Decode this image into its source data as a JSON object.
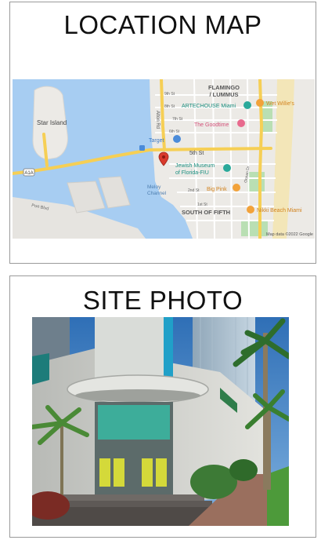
{
  "map_section": {
    "heading": "LOCATION MAP",
    "labels": {
      "neighborhood_line1": "FLAMINGO",
      "neighborhood_line2": "/ LUMMUS",
      "artechouse": "ARTECHOUSE Miami",
      "wet_willies": "Wet Willie's",
      "goodtime": "The Goodtime",
      "target": "Target",
      "fifth_st": "5th St",
      "jewish_museum_line1": "Jewish Museum",
      "jewish_museum_line2": "of Florida-FIU",
      "big_pink": "Big Pink",
      "star_island": "Star Island",
      "alton_rd": "Alton Rd",
      "meloy_channel_line1": "Meloy",
      "meloy_channel_line2": "Channel",
      "south_of_fifth": "SOUTH OF FIFTH",
      "nikki_beach": "Nikki Beach Miami",
      "port_blvd": "Port Blvd",
      "route_shield": "A1A",
      "ocean_dr": "Ocean Dr",
      "street_9th": "9th St",
      "street_8th": "8th St",
      "street_7th": "7th St",
      "street_6th": "6th St",
      "street_2nd": "2nd St",
      "street_1st": "1st St",
      "attribution": "Map data ©2022 Google"
    }
  },
  "photo_section": {
    "heading": "SITE PHOTO"
  }
}
